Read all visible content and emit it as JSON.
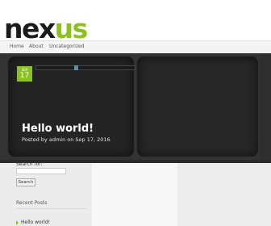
{
  "site": {
    "logo_part1": "nex",
    "logo_part2": "us"
  },
  "nav": {
    "items": [
      "Home",
      "About",
      "Uncategorized"
    ]
  },
  "slider": {
    "badge": {
      "month": "SEP",
      "day": "17"
    },
    "progress_fraction": 0.4,
    "post": {
      "title": "Hello world!",
      "meta": "Posted by admin on Sep 17, 2016"
    }
  },
  "sidebar": {
    "search_label": "Search for:",
    "search_button": "Search",
    "recent_posts_title": "Recent Posts",
    "recent_posts": [
      "Hello world!"
    ]
  },
  "colors": {
    "accent": "#8cc21f",
    "hero_bg": "#333333",
    "progress_handle": "#5e8cab"
  }
}
